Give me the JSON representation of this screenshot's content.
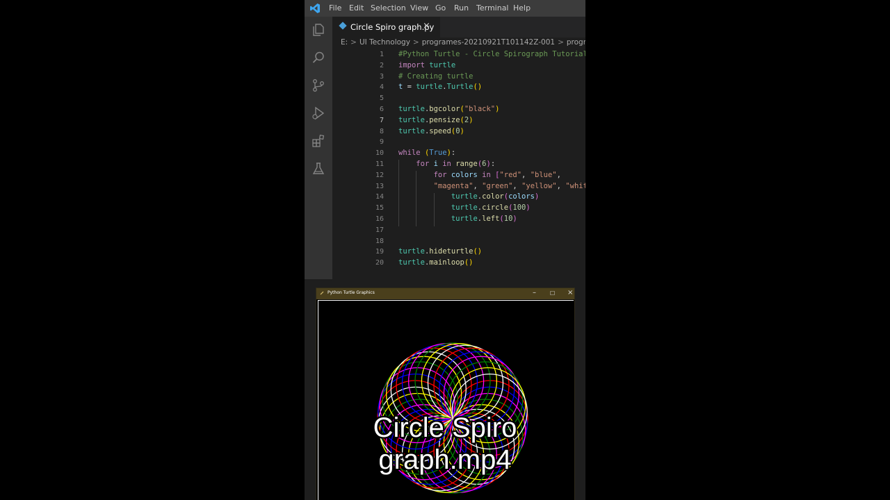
{
  "menu": [
    "File",
    "Edit",
    "Selection",
    "View",
    "Go",
    "Run",
    "Terminal",
    "Help"
  ],
  "activity_bar": [
    "explorer-icon",
    "search-icon",
    "source-control-icon",
    "run-debug-icon",
    "extensions-icon",
    "testing-icon"
  ],
  "tab": {
    "label": "Circle Spiro graph.py",
    "close": "×"
  },
  "breadcrumb": [
    "E:",
    "UI Technology",
    "programes-20210921T101142Z-001",
    "programes"
  ],
  "breadcrumb_sep": ">",
  "code": {
    "active_line": 7,
    "lines": [
      {
        "n": "1",
        "parts": [
          {
            "t": "#Python Turtle - Circle Spirograph Tutorial",
            "c": "#6a9955"
          }
        ]
      },
      {
        "n": "2",
        "parts": [
          {
            "t": "import",
            "c": "#c586c0"
          },
          {
            "t": " turtle",
            "c": "#4ec9b0"
          }
        ]
      },
      {
        "n": "3",
        "parts": [
          {
            "t": "# Creating turtle",
            "c": "#6a9955"
          }
        ]
      },
      {
        "n": "4",
        "parts": [
          {
            "t": "t",
            "c": "#9cdcfe"
          },
          {
            "t": " = ",
            "c": "#d4d4d4"
          },
          {
            "t": "turtle",
            "c": "#4ec9b0"
          },
          {
            "t": ".",
            "c": "#d4d4d4"
          },
          {
            "t": "Turtle",
            "c": "#4ec9b0"
          },
          {
            "t": "()",
            "c": "#ffd700"
          }
        ]
      },
      {
        "n": "5",
        "parts": []
      },
      {
        "n": "6",
        "parts": [
          {
            "t": "turtle",
            "c": "#4ec9b0"
          },
          {
            "t": ".",
            "c": "#d4d4d4"
          },
          {
            "t": "bgcolor",
            "c": "#dcdcaa"
          },
          {
            "t": "(",
            "c": "#ffd700"
          },
          {
            "t": "\"black\"",
            "c": "#ce9178"
          },
          {
            "t": ")",
            "c": "#ffd700"
          }
        ]
      },
      {
        "n": "7",
        "parts": [
          {
            "t": "turtle",
            "c": "#4ec9b0"
          },
          {
            "t": ".",
            "c": "#d4d4d4"
          },
          {
            "t": "pensize",
            "c": "#dcdcaa"
          },
          {
            "t": "(",
            "c": "#ffd700"
          },
          {
            "t": "2",
            "c": "#b5cea8"
          },
          {
            "t": ")",
            "c": "#ffd700"
          }
        ]
      },
      {
        "n": "8",
        "parts": [
          {
            "t": "turtle",
            "c": "#4ec9b0"
          },
          {
            "t": ".",
            "c": "#d4d4d4"
          },
          {
            "t": "speed",
            "c": "#dcdcaa"
          },
          {
            "t": "(",
            "c": "#ffd700"
          },
          {
            "t": "0",
            "c": "#b5cea8"
          },
          {
            "t": ")",
            "c": "#ffd700"
          }
        ]
      },
      {
        "n": "9",
        "parts": []
      },
      {
        "n": "10",
        "parts": [
          {
            "t": "while",
            "c": "#c586c0"
          },
          {
            "t": " ",
            "c": "#d4d4d4"
          },
          {
            "t": "(",
            "c": "#ffd700"
          },
          {
            "t": "True",
            "c": "#569cd6"
          },
          {
            "t": ")",
            "c": "#ffd700"
          },
          {
            "t": ":",
            "c": "#d4d4d4"
          }
        ]
      },
      {
        "n": "11",
        "parts": [
          {
            "t": "    ",
            "c": "#d4d4d4"
          },
          {
            "t": "for",
            "c": "#c586c0"
          },
          {
            "t": " i ",
            "c": "#9cdcfe"
          },
          {
            "t": "in",
            "c": "#c586c0"
          },
          {
            "t": " ",
            "c": "#d4d4d4"
          },
          {
            "t": "range",
            "c": "#dcdcaa"
          },
          {
            "t": "(",
            "c": "#da70d6"
          },
          {
            "t": "6",
            "c": "#b5cea8"
          },
          {
            "t": ")",
            "c": "#da70d6"
          },
          {
            "t": ":",
            "c": "#d4d4d4"
          }
        ]
      },
      {
        "n": "12",
        "parts": [
          {
            "t": "        ",
            "c": "#d4d4d4"
          },
          {
            "t": "for",
            "c": "#c586c0"
          },
          {
            "t": " colors ",
            "c": "#9cdcfe"
          },
          {
            "t": "in",
            "c": "#c586c0"
          },
          {
            "t": " ",
            "c": "#d4d4d4"
          },
          {
            "t": "[",
            "c": "#da70d6"
          },
          {
            "t": "\"red\"",
            "c": "#ce9178"
          },
          {
            "t": ", ",
            "c": "#d4d4d4"
          },
          {
            "t": "\"blue\"",
            "c": "#ce9178"
          },
          {
            "t": ",",
            "c": "#d4d4d4"
          }
        ]
      },
      {
        "n": "13",
        "parts": [
          {
            "t": "        ",
            "c": "#d4d4d4"
          },
          {
            "t": "\"magenta\"",
            "c": "#ce9178"
          },
          {
            "t": ", ",
            "c": "#d4d4d4"
          },
          {
            "t": "\"green\"",
            "c": "#ce9178"
          },
          {
            "t": ", ",
            "c": "#d4d4d4"
          },
          {
            "t": "\"yellow\"",
            "c": "#ce9178"
          },
          {
            "t": ", ",
            "c": "#d4d4d4"
          },
          {
            "t": "\"white\"",
            "c": "#ce9178"
          },
          {
            "t": "]",
            "c": "#da70d6"
          },
          {
            "t": ":",
            "c": "#d4d4d4"
          }
        ]
      },
      {
        "n": "14",
        "parts": [
          {
            "t": "            ",
            "c": "#d4d4d4"
          },
          {
            "t": "turtle",
            "c": "#4ec9b0"
          },
          {
            "t": ".",
            "c": "#d4d4d4"
          },
          {
            "t": "color",
            "c": "#dcdcaa"
          },
          {
            "t": "(",
            "c": "#da70d6"
          },
          {
            "t": "colors",
            "c": "#9cdcfe"
          },
          {
            "t": ")",
            "c": "#da70d6"
          }
        ]
      },
      {
        "n": "15",
        "parts": [
          {
            "t": "            ",
            "c": "#d4d4d4"
          },
          {
            "t": "turtle",
            "c": "#4ec9b0"
          },
          {
            "t": ".",
            "c": "#d4d4d4"
          },
          {
            "t": "circle",
            "c": "#dcdcaa"
          },
          {
            "t": "(",
            "c": "#da70d6"
          },
          {
            "t": "100",
            "c": "#b5cea8"
          },
          {
            "t": ")",
            "c": "#da70d6"
          }
        ]
      },
      {
        "n": "16",
        "parts": [
          {
            "t": "            ",
            "c": "#d4d4d4"
          },
          {
            "t": "turtle",
            "c": "#4ec9b0"
          },
          {
            "t": ".",
            "c": "#d4d4d4"
          },
          {
            "t": "left",
            "c": "#dcdcaa"
          },
          {
            "t": "(",
            "c": "#da70d6"
          },
          {
            "t": "10",
            "c": "#b5cea8"
          },
          {
            "t": ")",
            "c": "#da70d6"
          }
        ]
      },
      {
        "n": "17",
        "parts": []
      },
      {
        "n": "18",
        "parts": []
      },
      {
        "n": "19",
        "parts": [
          {
            "t": "turtle",
            "c": "#4ec9b0"
          },
          {
            "t": ".",
            "c": "#d4d4d4"
          },
          {
            "t": "hideturtle",
            "c": "#dcdcaa"
          },
          {
            "t": "()",
            "c": "#ffd700"
          }
        ]
      },
      {
        "n": "20",
        "parts": [
          {
            "t": "turtle",
            "c": "#4ec9b0"
          },
          {
            "t": ".",
            "c": "#d4d4d4"
          },
          {
            "t": "mainloop",
            "c": "#dcdcaa"
          },
          {
            "t": "()",
            "c": "#ffd700"
          }
        ]
      }
    ]
  },
  "turtle_window": {
    "title": "Python Turtle Graphics",
    "minimize": "–",
    "maximize": "☐",
    "close": "×",
    "spiro_colors": [
      "red",
      "blue",
      "magenta",
      "green",
      "yellow",
      "white"
    ],
    "circles_per_color_cycle": 6,
    "turn_degrees": 10
  },
  "caption": {
    "line1": "Circle Spiro",
    "line2": "graph.mp4"
  }
}
